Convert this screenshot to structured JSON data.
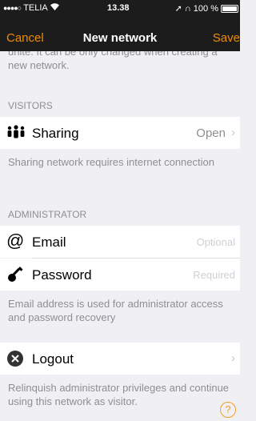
{
  "status_bar": {
    "carrier": "TELIA",
    "time": "13.38",
    "battery": "100 %"
  },
  "nav": {
    "cancel": "Cancel",
    "title": "New network",
    "save": "Save"
  },
  "intro_text": "unite. It can be only changed when creating a new network.",
  "visitors": {
    "header": "VISITORS",
    "sharing_label": "Sharing",
    "sharing_value": "Open",
    "note": "Sharing network requires internet connection"
  },
  "administrator": {
    "header": "ADMINISTRATOR",
    "email_label": "Email",
    "email_placeholder": "Optional",
    "password_label": "Password",
    "password_placeholder": "Required",
    "note": "Email address is used for administrator access and password recovery"
  },
  "logout": {
    "label": "Logout",
    "note": "Relinquish administrator privileges and continue using this network as visitor."
  },
  "help": "?",
  "colors": {
    "accent": "#f08c00",
    "bar": "#1c1c1c",
    "background": "#efeff4"
  }
}
